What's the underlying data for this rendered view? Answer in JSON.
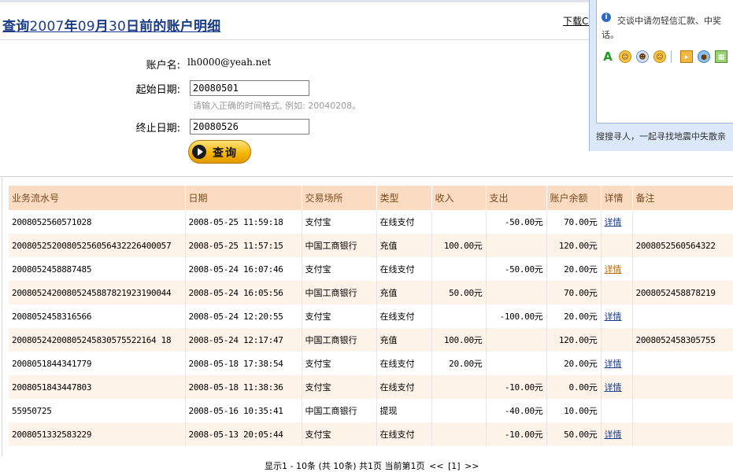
{
  "title": {
    "prefix": "查询",
    "year": "2007",
    "nian": "年",
    "month": "09",
    "yue": "月",
    "day": "30",
    "suffix": "日前的账户明细"
  },
  "download_link": "下载CS",
  "form": {
    "account_label": "账户名:",
    "account_value": "lh0000@yeah.net",
    "start_label": "起始日期:",
    "start_value": "20080501",
    "hint": "请输入正确的时间格式, 例如: 20040208。",
    "end_label": "终止日期:",
    "end_value": "20080526",
    "query_button": "查询"
  },
  "chat": {
    "notice": "交谈中请勿轻信汇款、中奖话。",
    "search_text": "搜搜寻人，一起寻找地震中失散亲"
  },
  "table": {
    "headers": [
      "业务流水号",
      "日期",
      "交易场所",
      "类型",
      "收入",
      "支出",
      "账户余额",
      "详情",
      "备注"
    ],
    "rows": [
      {
        "id": "2008052560571028",
        "date": "2008-05-25 11:59:18",
        "place": "支付宝",
        "type": "在线支付",
        "income": "",
        "expense": "-50.00元",
        "balance": "70.00元",
        "detail": "详情",
        "note": ""
      },
      {
        "id": "20080525200805256056432226400057",
        "date": "2008-05-25 11:57:15",
        "place": "中国工商银行",
        "type": "充值",
        "income": "100.00元",
        "expense": "",
        "balance": "120.00元",
        "detail": "",
        "note": "2008052560564322"
      },
      {
        "id": "2008052458887485",
        "date": "2008-05-24 16:07:46",
        "place": "支付宝",
        "type": "在线支付",
        "income": "",
        "expense": "-50.00元",
        "balance": "20.00元",
        "detail": "详情",
        "note": ""
      },
      {
        "id": "20080524200805245887821923190044",
        "date": "2008-05-24 16:05:56",
        "place": "中国工商银行",
        "type": "充值",
        "income": "50.00元",
        "expense": "",
        "balance": "70.00元",
        "detail": "",
        "note": "2008052458878219"
      },
      {
        "id": "2008052458316566",
        "date": "2008-05-24 12:20:55",
        "place": "支付宝",
        "type": "在线支付",
        "income": "",
        "expense": "-100.00元",
        "balance": "20.00元",
        "detail": "详情",
        "note": ""
      },
      {
        "id": "20080524200805245830575522164 18",
        "date": "2008-05-24 12:17:47",
        "place": "中国工商银行",
        "type": "充值",
        "income": "100.00元",
        "expense": "",
        "balance": "120.00元",
        "detail": "",
        "note": "2008052458305755"
      },
      {
        "id": "2008051844341779",
        "date": "2008-05-18 17:38:54",
        "place": "支付宝",
        "type": "在线支付",
        "income": "20.00元",
        "expense": "",
        "balance": "20.00元",
        "detail": "详情",
        "note": ""
      },
      {
        "id": "2008051843447803",
        "date": "2008-05-18 11:38:36",
        "place": "支付宝",
        "type": "在线支付",
        "income": "",
        "expense": "-10.00元",
        "balance": "0.00元",
        "detail": "详情",
        "note": ""
      },
      {
        "id": "55950725",
        "date": "2008-05-16 10:35:41",
        "place": "中国工商银行",
        "type": "提现",
        "income": "",
        "expense": "-40.00元",
        "balance": "10.00元",
        "detail": "",
        "note": ""
      },
      {
        "id": "2008051332583229",
        "date": "2008-05-13 20:05:44",
        "place": "支付宝",
        "type": "在线支付",
        "income": "",
        "expense": "-10.00元",
        "balance": "50.00元",
        "detail": "详情",
        "note": ""
      }
    ]
  },
  "pager": {
    "summary": "显示1 - 10条 (共 10条) 共1页 当前第1页",
    "prev": "<<",
    "current": "[1]",
    "next": ">>"
  }
}
